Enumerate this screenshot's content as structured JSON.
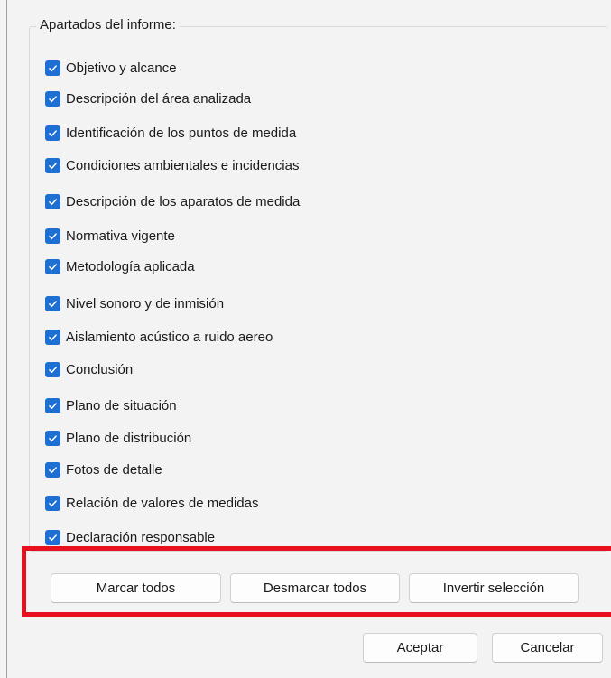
{
  "group": {
    "title": "Apartados del informe:"
  },
  "items": [
    {
      "label": "Objetivo y alcance",
      "checked": true
    },
    {
      "label": "Descripción del área analizada",
      "checked": true
    },
    {
      "label": "Identificación de los puntos de medida",
      "checked": true
    },
    {
      "label": "Condiciones ambientales e incidencias",
      "checked": true
    },
    {
      "label": "Descripción de los aparatos de medida",
      "checked": true
    },
    {
      "label": "Normativa vigente",
      "checked": true
    },
    {
      "label": "Metodología aplicada",
      "checked": true
    },
    {
      "label": "Nivel sonoro y de inmisión",
      "checked": true
    },
    {
      "label": "Aislamiento acústico a ruido aereo",
      "checked": true
    },
    {
      "label": "Conclusión",
      "checked": true
    },
    {
      "label": "Plano de situación",
      "checked": true
    },
    {
      "label": "Plano de distribución",
      "checked": true
    },
    {
      "label": "Fotos de detalle",
      "checked": true
    },
    {
      "label": "Relación de valores de medidas",
      "checked": true
    },
    {
      "label": "Declaración responsable",
      "checked": true
    }
  ],
  "selection_buttons": {
    "mark_all": "Marcar todos",
    "unmark_all": "Desmarcar todos",
    "invert": "Invertir selección"
  },
  "dialog_buttons": {
    "accept": "Aceptar",
    "cancel": "Cancelar"
  },
  "colors": {
    "checkbox_accent": "#1d6fd1",
    "highlight_outline": "#e8101f"
  }
}
